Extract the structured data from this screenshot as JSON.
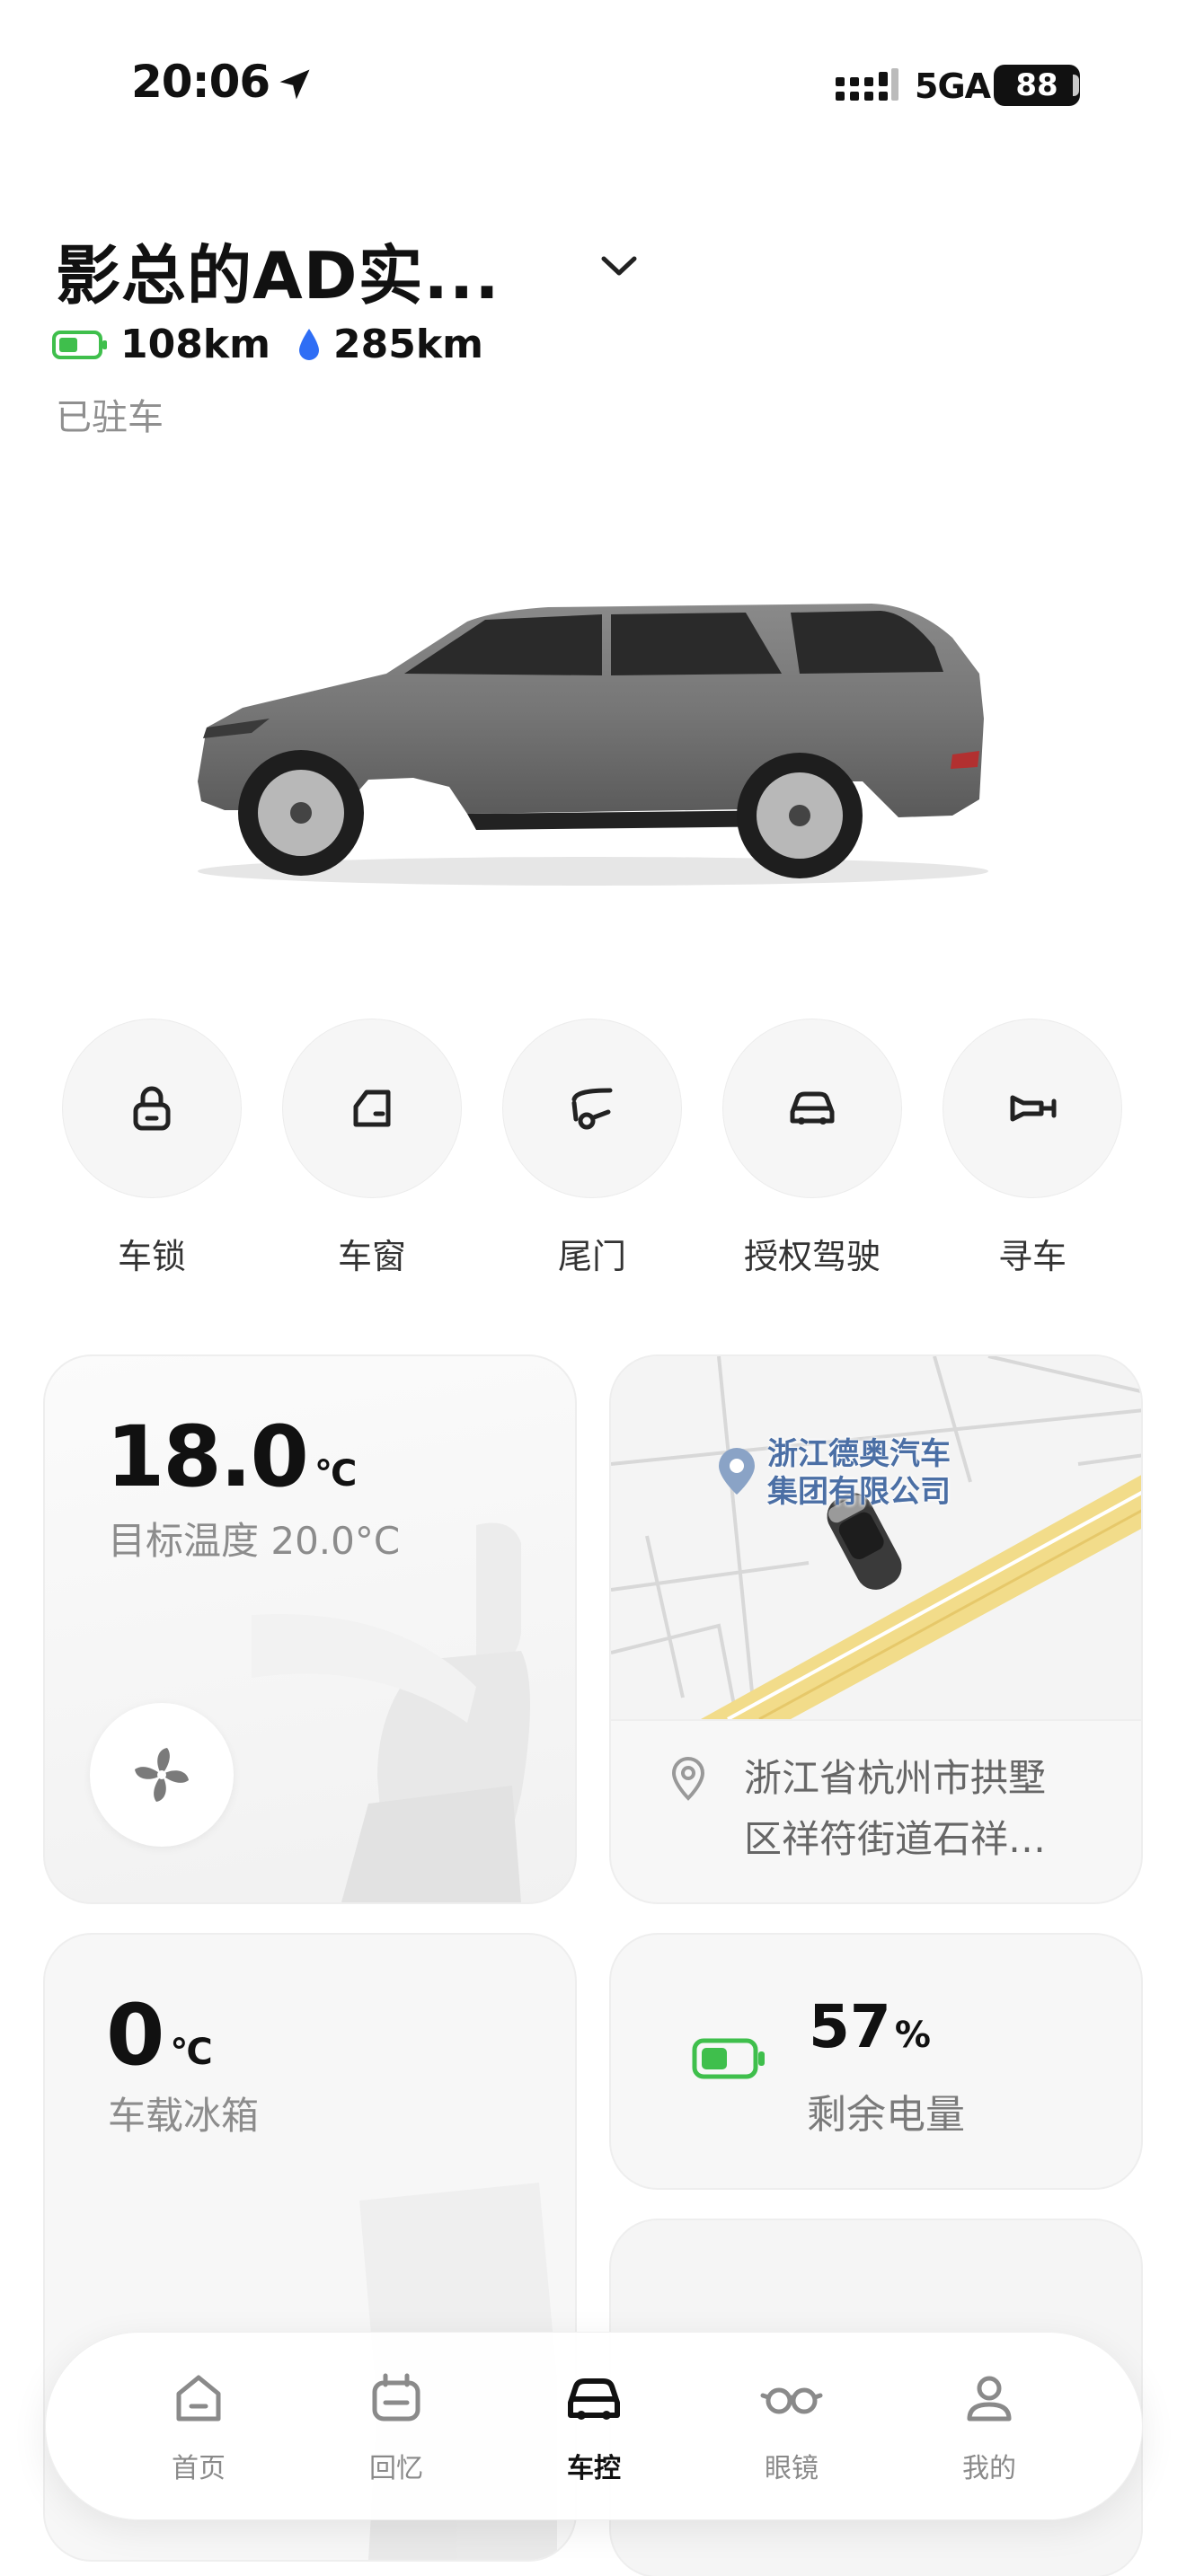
{
  "status_bar": {
    "time": "20:06",
    "network": "5GA",
    "battery": "88"
  },
  "vehicle": {
    "name": "影总的AD实...",
    "electric_range": "108km",
    "fuel_range": "285km",
    "status": "已驻车"
  },
  "controls": [
    {
      "label": "车锁",
      "icon": "lock-icon"
    },
    {
      "label": "车窗",
      "icon": "window-icon"
    },
    {
      "label": "尾门",
      "icon": "tailgate-icon"
    },
    {
      "label": "授权驾驶",
      "icon": "authorized-drive-icon"
    },
    {
      "label": "寻车",
      "icon": "horn-icon"
    }
  ],
  "climate": {
    "temperature": "18.0",
    "unit": "°C",
    "target": "目标温度 20.0°C"
  },
  "location": {
    "poi": [
      "浙江德奥汽车",
      "集团有限公司"
    ],
    "address_line1": "浙江省杭州市拱墅",
    "address_line2": "区祥符街道石祥…"
  },
  "fridge": {
    "temperature": "0",
    "unit": "°C",
    "label": "车载冰箱"
  },
  "battery": {
    "percent": "57",
    "unit": "%",
    "label": "剩余电量"
  },
  "nav": [
    {
      "label": "首页",
      "icon": "home-icon",
      "active": false
    },
    {
      "label": "回忆",
      "icon": "memories-icon",
      "active": false
    },
    {
      "label": "车控",
      "icon": "car-control-icon",
      "active": true
    },
    {
      "label": "眼镜",
      "icon": "glasses-icon",
      "active": false
    },
    {
      "label": "我的",
      "icon": "profile-icon",
      "active": false
    }
  ],
  "colors": {
    "accent_green": "#3fbf4c",
    "fuel_blue": "#2f6ef5",
    "map_road": "#f2dc8a"
  }
}
